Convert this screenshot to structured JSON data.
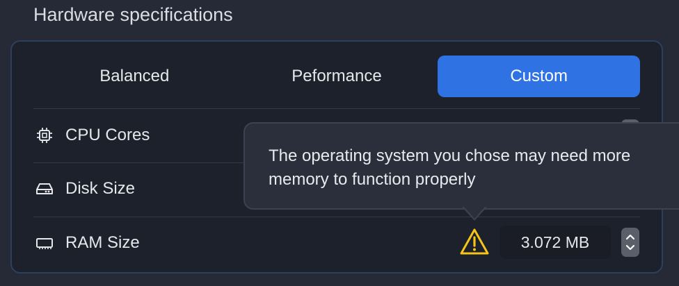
{
  "section": {
    "title": "Hardware specifications"
  },
  "presets": {
    "options": [
      "Balanced",
      "Peformance",
      "Custom"
    ],
    "selected": "Custom"
  },
  "rows": [
    {
      "label": "CPU Cores",
      "icon": "cpu-icon"
    },
    {
      "label": "Disk Size",
      "icon": "disk-icon"
    },
    {
      "label": "RAM Size",
      "icon": "memory-icon",
      "value": "3.072 MB"
    }
  ],
  "warning": {
    "icon": "warning-icon",
    "tooltip": "The operating system you chose may need more memory to function properly"
  },
  "colors": {
    "accent": "#2f72e4",
    "warning": "#f5c518",
    "panel_border": "#2e3f5e"
  }
}
